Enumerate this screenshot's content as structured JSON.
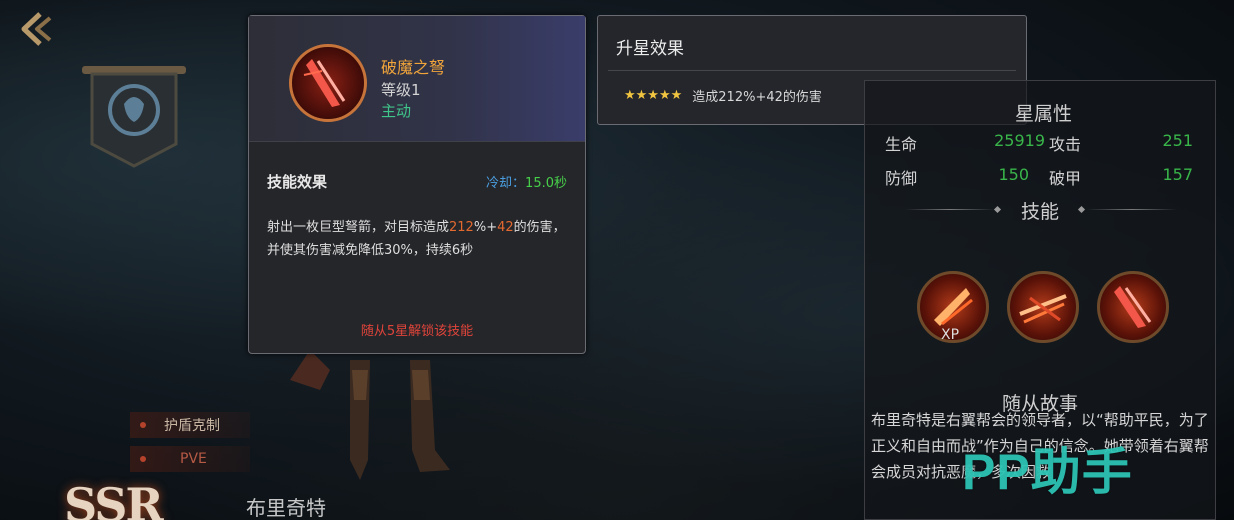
{
  "skill_tooltip": {
    "name": "破魔之弩",
    "level": "等级1",
    "type": "主动",
    "effect_title": "技能效果",
    "cooldown_label": "冷却：",
    "cooldown_value": "15.0秒",
    "desc_part1": "射出一枚巨型弩箭，对目标造成",
    "desc_hl1": "212",
    "desc_part2": "%+",
    "desc_hl2": "42",
    "desc_part3": "的伤害，并使其伤害减免降低30%，持续6秒",
    "unlock_text": "随从5星解锁该技能",
    "colors": {
      "name": "#f0a43a",
      "type": "#3fc48a",
      "highlight": "#e3692f",
      "unlock": "#e0443a"
    }
  },
  "star_tooltip": {
    "title": "升星效果",
    "stars": "★★★★★",
    "effect": "造成212%+42的伤害"
  },
  "attr_panel": {
    "heading_partial": "星属性",
    "stats": [
      {
        "label": "生命",
        "value": "25919"
      },
      {
        "label": "攻击",
        "value": "251"
      },
      {
        "label": "防御",
        "value": "150"
      },
      {
        "label": "破甲",
        "value": "157"
      }
    ],
    "skills_heading": "技能",
    "xp_label": "XP",
    "story_heading": "随从故事",
    "story_text": "布里奇特是右翼帮会的领导者，以“帮助平民，为了正义和自由而战”作为自己的信念。她带领着右翼帮会成员对抗恶魔，多次因救"
  },
  "left_side": {
    "tag_shield": "护盾克制",
    "tag_pve": "PVE",
    "hero_name": "布里奇特",
    "rank": "SSR"
  },
  "watermark": "PP助手"
}
